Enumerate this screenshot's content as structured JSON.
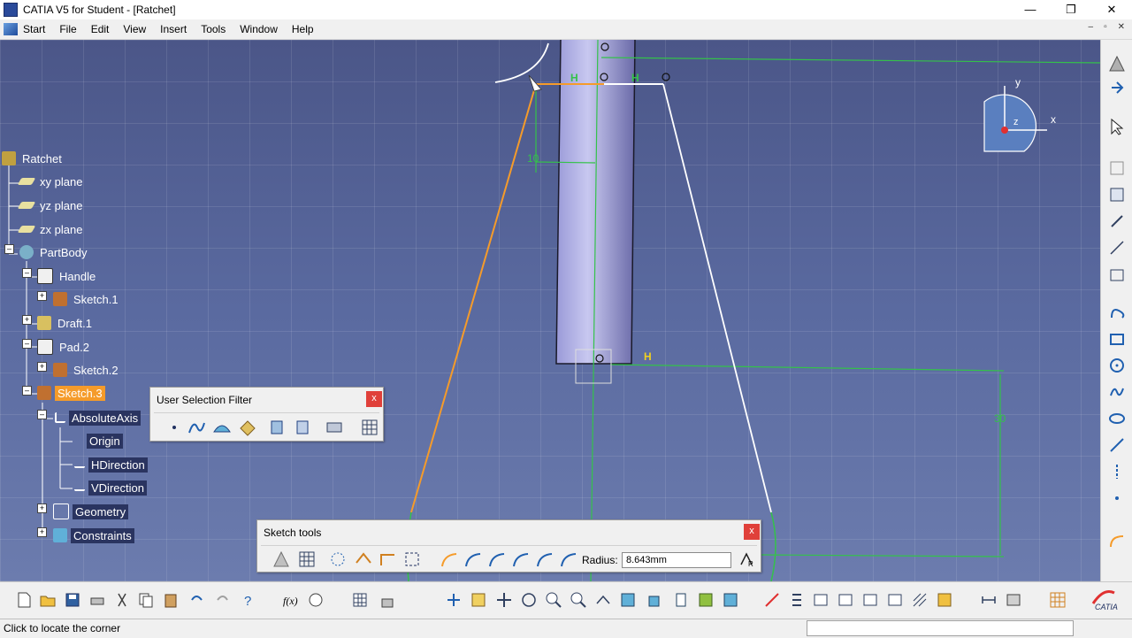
{
  "window": {
    "title": "CATIA V5 for Student - [Ratchet]"
  },
  "window_controls": {
    "minimize": "—",
    "maximize": "❐",
    "close": "✕"
  },
  "menubar": {
    "items": [
      "Start",
      "File",
      "Edit",
      "View",
      "Insert",
      "Tools",
      "Window",
      "Help"
    ],
    "mdi_controls": [
      "–",
      "▫",
      "✕"
    ]
  },
  "tree": {
    "nodes": [
      {
        "label": "Ratchet"
      },
      {
        "label": "xy plane"
      },
      {
        "label": "yz plane"
      },
      {
        "label": "zx plane"
      },
      {
        "label": "PartBody"
      },
      {
        "label": "Handle"
      },
      {
        "label": "Sketch.1"
      },
      {
        "label": "Draft.1"
      },
      {
        "label": "Pad.2"
      },
      {
        "label": "Sketch.2"
      },
      {
        "label": "Sketch.3"
      },
      {
        "label": "AbsoluteAxis"
      },
      {
        "label": "Origin"
      },
      {
        "label": "HDirection"
      },
      {
        "label": "VDirection"
      },
      {
        "label": "Geometry"
      },
      {
        "label": "Constraints"
      }
    ]
  },
  "user_selection_filter": {
    "title": "User Selection Filter",
    "close": "x"
  },
  "sketch_tools": {
    "title": "Sketch tools",
    "radius_label": "Radius:",
    "radius_value": "8.643mm",
    "close": "x"
  },
  "compass": {
    "x": "x",
    "y": "y",
    "z": "z"
  },
  "sketch": {
    "dim_10": "10",
    "dim_30": "30",
    "h1": "H",
    "h2": "H",
    "h3": "H"
  },
  "status": {
    "message": "Click to locate the corner"
  },
  "colors": {
    "viewport": "#5a6aa0",
    "constraint": "#34c24a",
    "selection": "#f59b2a"
  }
}
